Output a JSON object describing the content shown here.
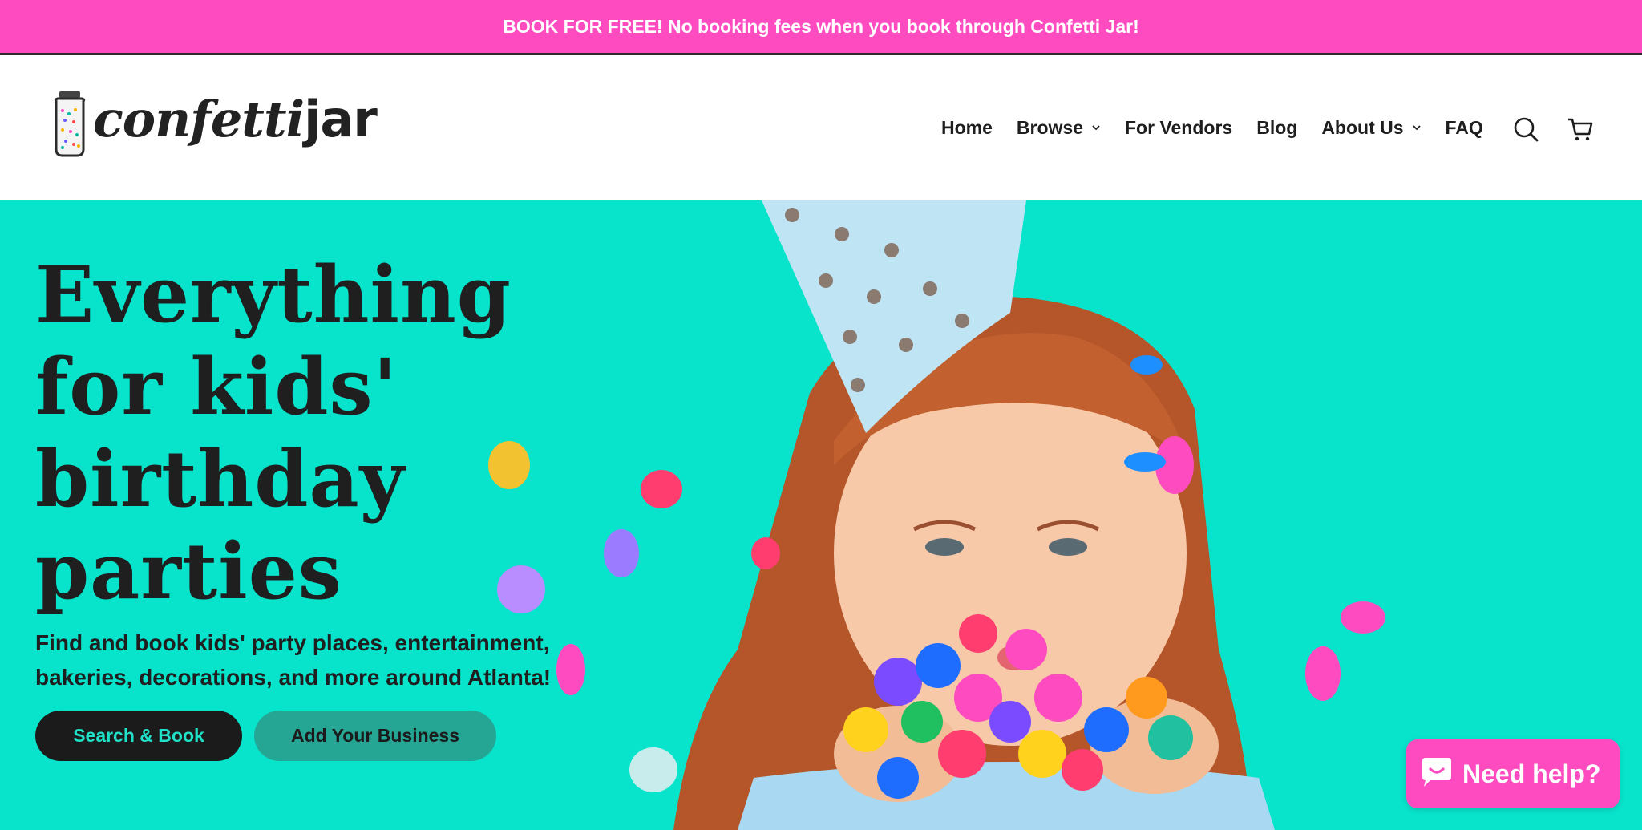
{
  "announcement": {
    "text": "BOOK FOR FREE! No booking fees when you book through Confetti Jar!"
  },
  "header": {
    "logo": {
      "word1": "confetti",
      "word2": "jar"
    },
    "nav": [
      {
        "label": "Home",
        "has_dropdown": false
      },
      {
        "label": "Browse",
        "has_dropdown": true
      },
      {
        "label": "For Vendors",
        "has_dropdown": false
      },
      {
        "label": "Blog",
        "has_dropdown": false
      },
      {
        "label": "About Us",
        "has_dropdown": true
      },
      {
        "label": "FAQ",
        "has_dropdown": false
      }
    ],
    "icons": [
      "search-icon",
      "cart-icon"
    ]
  },
  "hero": {
    "title_lines": [
      "Everything",
      "for kids'",
      "birthday",
      "parties"
    ],
    "subtitle_lines": [
      "Find and book kids' party places, entertainment,",
      "bakeries, decorations, and more around Atlanta!"
    ],
    "primary_button": "Search & Book",
    "secondary_button": "Add Your Business"
  },
  "chat_widget": {
    "label": "Need help?",
    "icon": "chat-bubble-icon"
  },
  "colors": {
    "announcement_bg": "#ff4bc0",
    "hero_bg": "#08e4cc",
    "primary_button_bg": "#1b1b1b",
    "primary_button_text": "#20e0c8",
    "secondary_button_bg": "#25a694",
    "chat_widget_bg": "#ff4bc0"
  }
}
